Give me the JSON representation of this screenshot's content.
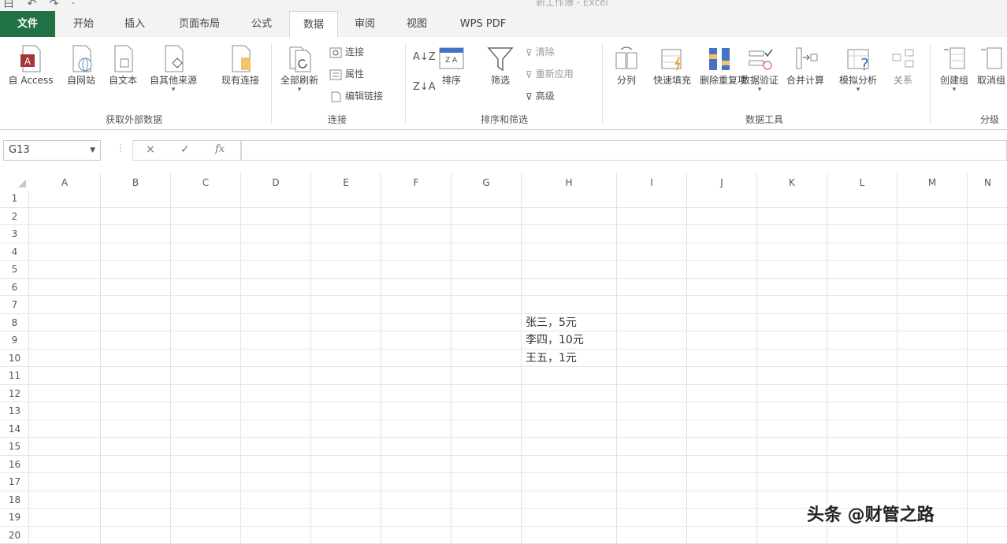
{
  "quick_access": "白 ↶ ↷ ·",
  "document_title": "新工作簿 - Excel",
  "tabs": [
    "文件",
    "开始",
    "插入",
    "页面布局",
    "公式",
    "数据",
    "审阅",
    "视图",
    "WPS PDF"
  ],
  "ribbon": {
    "get_external": {
      "group_label": "获取外部数据",
      "buttons": [
        "自 Access",
        "自网站",
        "自文本",
        "自其他来源",
        "现有连接"
      ]
    },
    "connections": {
      "group_label": "连接",
      "refresh_all": "全部刷新",
      "small": [
        "连接",
        "属性",
        "编辑链接"
      ]
    },
    "sort_filter": {
      "group_label": "排序和筛选",
      "sort": "排序",
      "filter": "筛选",
      "small": [
        "清除",
        "重新应用",
        "高级"
      ]
    },
    "data_tools": {
      "group_label": "数据工具",
      "buttons": [
        "分列",
        "快速填充",
        "删除重复项",
        "数据验证",
        "合并计算",
        "模拟分析",
        "关系"
      ]
    },
    "outline": {
      "group_label": "分级",
      "buttons": [
        "创建组",
        "取消组"
      ]
    }
  },
  "formula_bar": {
    "name_box": "G13",
    "cancel": "×",
    "enter": "✓",
    "fx": "fx",
    "value": ""
  },
  "columns": [
    "A",
    "B",
    "C",
    "D",
    "E",
    "F",
    "G",
    "H",
    "I",
    "J",
    "K",
    "L",
    "M",
    "N"
  ],
  "rows": [
    "1",
    "2",
    "3",
    "4",
    "5",
    "6",
    "7",
    "8",
    "9",
    "10",
    "11",
    "12",
    "13",
    "14",
    "15",
    "16",
    "17",
    "18",
    "19",
    "20"
  ],
  "cells": {
    "H8": "张三，5元",
    "H9": "李四，10元",
    "H10": "王五，1元"
  },
  "watermark": "头条 @财管之路",
  "colors": {
    "file_tab": "#217346",
    "grid": "#e2e2e2"
  }
}
